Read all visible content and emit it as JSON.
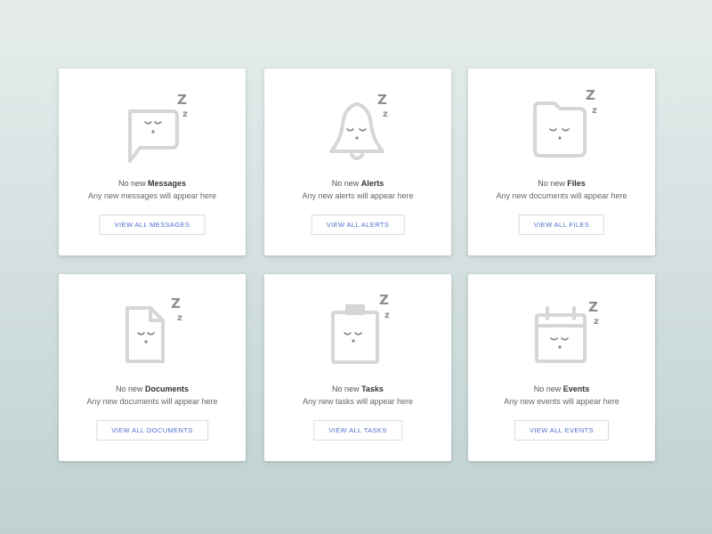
{
  "cards": [
    {
      "prefix": "No new",
      "name": "Messages",
      "sub": "Any new messages will appear here",
      "button": "VIEW ALL MESSAGES"
    },
    {
      "prefix": "No new",
      "name": "Alerts",
      "sub": "Any new alerts will appear here",
      "button": "VIEW ALL ALERTS"
    },
    {
      "prefix": "No new",
      "name": "Files",
      "sub": "Any new documents will appear here",
      "button": "VIEW ALL FILES"
    },
    {
      "prefix": "No new",
      "name": "Documents",
      "sub": "Any new documents will appear here",
      "button": "VIEW ALL DOCUMENTS"
    },
    {
      "prefix": "No new",
      "name": "Tasks",
      "sub": "Any new tasks will appear here",
      "button": "VIEW ALL TASKS"
    },
    {
      "prefix": "No new",
      "name": "Events",
      "sub": "Any new events will appear here",
      "button": "VIEW ALL EVENTS"
    }
  ],
  "icons": [
    "chat-bubble-icon",
    "bell-icon",
    "folder-icon",
    "document-icon",
    "clipboard-icon",
    "calendar-icon"
  ],
  "sleep_glyph": {
    "big": "Z",
    "small": "z"
  },
  "colors": {
    "accent": "#4d6fcf",
    "icon_outline": "#d6d6d6",
    "icon_face": "#888888",
    "card": "#ffffff"
  }
}
